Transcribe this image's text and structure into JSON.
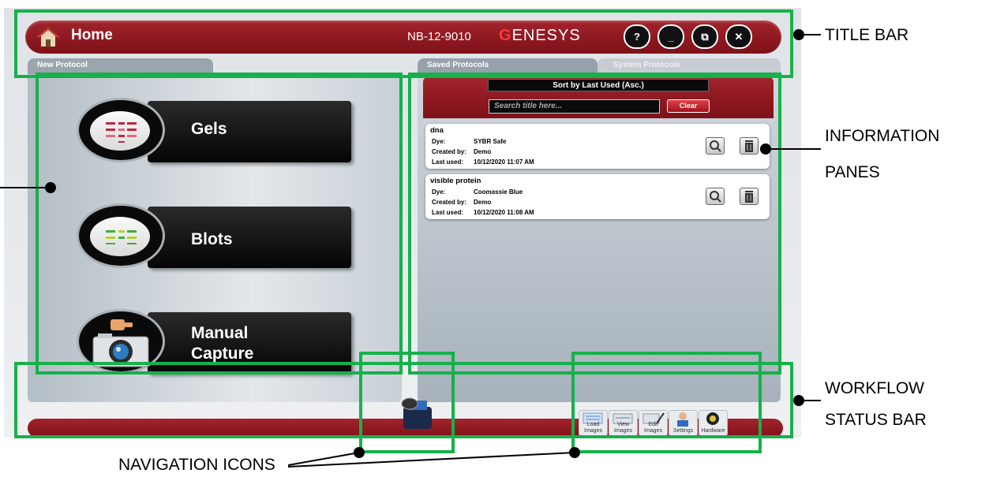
{
  "title_bar": {
    "home_label": "Home",
    "serial": "NB-12-9010",
    "brand_first": "G",
    "brand_rest": "ENESYS",
    "help": "?",
    "minimize": "_",
    "restore": "⧉",
    "close": "✕"
  },
  "tabs": {
    "new_protocol": "New Protocol",
    "saved_protocols": "Saved Protocols",
    "system_protocols": "System Protocols"
  },
  "protocol_buttons": [
    {
      "label": "Gels"
    },
    {
      "label": "Blots"
    },
    {
      "label_line1": "Manual",
      "label_line2": "Capture"
    }
  ],
  "saved": {
    "sort_value": "Sort by Last Used (Asc.)",
    "search_placeholder": "Search title here...",
    "clear_label": "Clear",
    "field_labels": {
      "dye": "Dye:",
      "created_by": "Created by:",
      "last_used": "Last used:"
    },
    "items": [
      {
        "title": "dna",
        "dye": "SYBR Safe",
        "created_by": "Demo",
        "last_used": "10/12/2020 11:07 AM"
      },
      {
        "title": "visible protein",
        "dye": "Coomassie Blue",
        "created_by": "Demo",
        "last_used": "10/12/2020 11:08 AM"
      }
    ]
  },
  "nav_buttons": [
    "Load Images",
    "View Images",
    "Edit Images",
    "Settings",
    "Hardware"
  ],
  "annotations": {
    "title_bar": "TITLE BAR",
    "info_panes_1": "INFORMATION",
    "info_panes_2": "PANES",
    "workflow_1": "WORKFLOW",
    "workflow_2": "STATUS BAR",
    "nav_icons": "NAVIGATION ICONS"
  },
  "colors": {
    "accent_red": "#8f1820",
    "annotation_green": "#17b04a",
    "brand_g": "#ff3a3a"
  },
  "icons": [
    "home-icon",
    "help-icon",
    "minimize-icon",
    "restore-icon",
    "close-icon",
    "gel-icon",
    "blot-icon",
    "camera-icon",
    "magnify-icon",
    "trash-icon",
    "printer-icon"
  ]
}
